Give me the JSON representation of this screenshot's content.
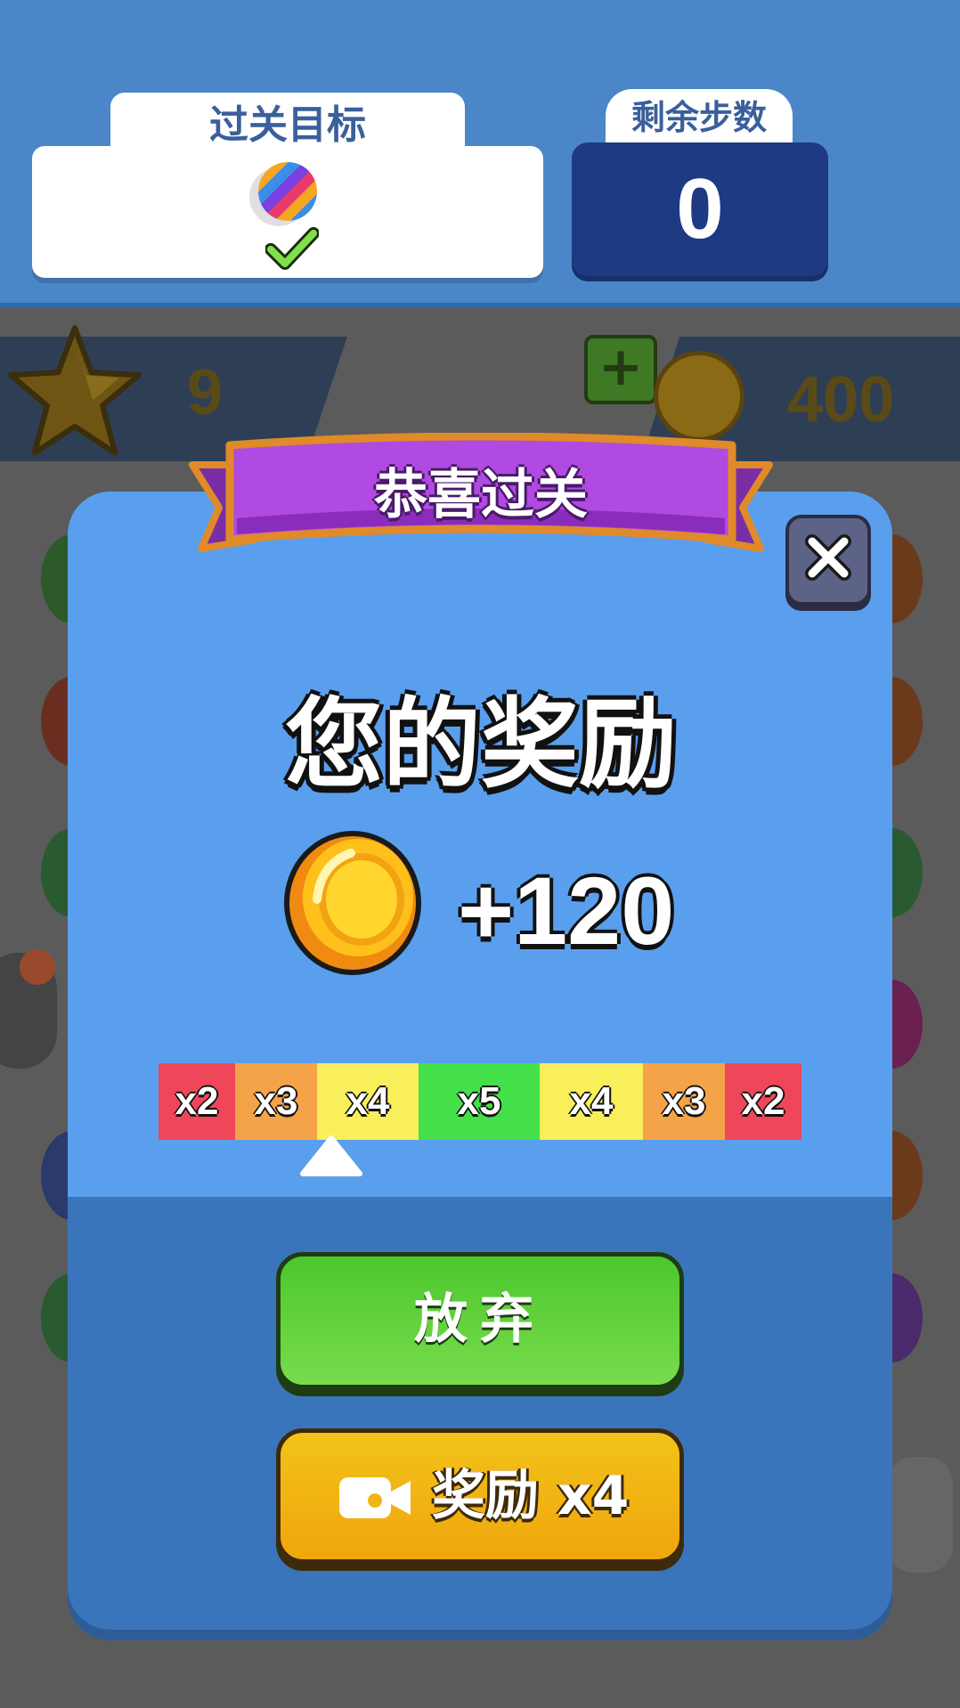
{
  "header": {
    "goal_title": "过关目标",
    "goal_item": "rainbow-ball",
    "goal_completed": true,
    "steps_title": "剩余步数",
    "steps_value": "0"
  },
  "stats": {
    "stars": "9",
    "coins": "400"
  },
  "modal": {
    "ribbon_title": "恭喜过关",
    "reward_title": "您的奖励",
    "reward_amount": "+120",
    "multipliers": [
      {
        "label": "x2",
        "color": "#f0465a"
      },
      {
        "label": "x3",
        "color": "#f5a348"
      },
      {
        "label": "x4",
        "color": "#f8ef5a"
      },
      {
        "label": "x5",
        "color": "#44e04a"
      },
      {
        "label": "x4",
        "color": "#f8ef5a"
      },
      {
        "label": "x3",
        "color": "#f5a348"
      },
      {
        "label": "x2",
        "color": "#f0465a"
      }
    ],
    "pointer_segment": "x4",
    "give_up_label": "放弃",
    "reward_video_label": "奖励 x4"
  },
  "colors": {
    "header_blue": "#4a86c8",
    "modal_blue": "#5a9fed",
    "ribbon_purple": "#a73fd7",
    "give_up_green": "#5fd03a",
    "reward_yellow": "#f2b512"
  }
}
